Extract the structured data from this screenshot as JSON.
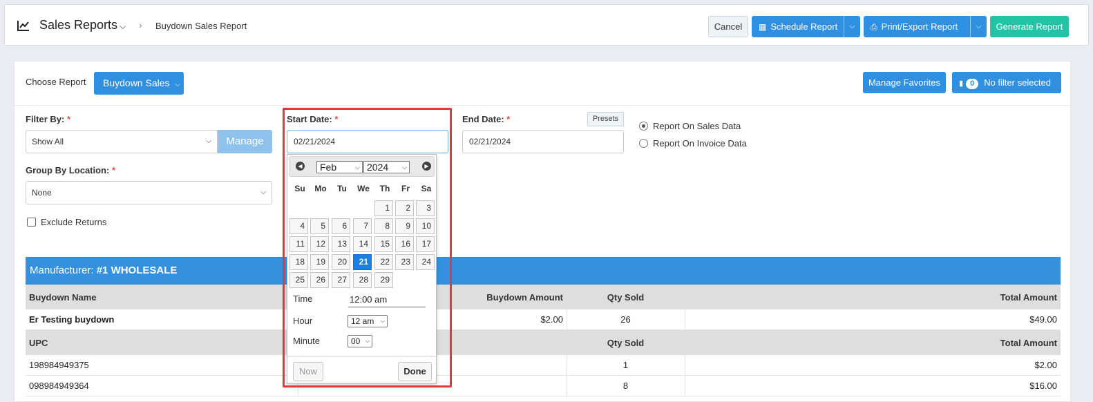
{
  "header": {
    "title": "Sales Reports",
    "breadcrumb_current": "Buydown Sales Report",
    "cancel_label": "Cancel",
    "schedule_label": "Schedule Report",
    "print_label": "Print/Export Report",
    "generate_label": "Generate Report"
  },
  "toolbar": {
    "choose_label": "Choose Report",
    "report_select": "Buydown Sales",
    "manage_favorites": "Manage Favorites",
    "filter_count": "0",
    "filter_status": "No filter selected"
  },
  "filters": {
    "filter_by_label": "Filter By:",
    "filter_by_value": "Show All",
    "manage_label": "Manage",
    "group_by_label": "Group By Location:",
    "group_by_value": "None",
    "exclude_returns_label": "Exclude Returns",
    "start_date_label": "Start Date:",
    "start_date_value": "02/21/2024",
    "end_date_label": "End Date:",
    "end_date_value": "02/21/2024",
    "presets_label": "Presets",
    "radio_sales": "Report On Sales Data",
    "radio_invoice": "Report On Invoice Data",
    "required_mark": "*"
  },
  "datepicker": {
    "month": "Feb",
    "year": "2024",
    "dow": [
      "Su",
      "Mo",
      "Tu",
      "We",
      "Th",
      "Fr",
      "Sa"
    ],
    "days": [
      "1",
      "2",
      "3",
      "4",
      "5",
      "6",
      "7",
      "8",
      "9",
      "10",
      "11",
      "12",
      "13",
      "14",
      "15",
      "16",
      "17",
      "18",
      "19",
      "20",
      "21",
      "22",
      "23",
      "24",
      "25",
      "26",
      "27",
      "28",
      "29"
    ],
    "selected_day": "21",
    "time_label": "Time",
    "time_value": "12:00 am",
    "hour_label": "Hour",
    "hour_value": "12 am",
    "minute_label": "Minute",
    "minute_value": "00",
    "now_label": "Now",
    "done_label": "Done"
  },
  "table": {
    "manufacturer_prefix": "Manufacturer:",
    "manufacturer_name": "#1 WHOLESALE",
    "header1": {
      "name": "Buydown Name",
      "amount": "Buydown Amount",
      "qty": "Qty Sold",
      "total": "Total Amount"
    },
    "buydown_row": {
      "name": "Er Testing buydown",
      "amount": "$2.00",
      "qty": "26",
      "total": "$49.00"
    },
    "header2": {
      "name": "UPC",
      "qty": "Qty Sold",
      "total": "Total Amount"
    },
    "upc_rows": [
      {
        "upc": "198984949375",
        "qty": "1",
        "total": "$2.00"
      },
      {
        "upc": "098984949364",
        "qty": "8",
        "total": "$16.00"
      }
    ]
  },
  "colors": {
    "primary": "#2f8fe0",
    "generate": "#21c5a5",
    "highlight": "#e23a3a",
    "selected_day": "#1a7fe0"
  }
}
